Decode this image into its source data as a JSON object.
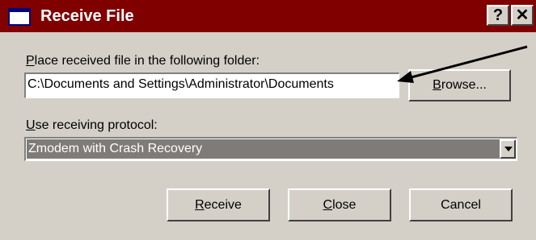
{
  "window": {
    "title": "Receive File",
    "help_glyph": "?",
    "close_glyph": "✕",
    "icon": "window-icon"
  },
  "folder": {
    "label_accel": "P",
    "label_rest": "lace received file in the following folder:",
    "value": "C:\\Documents and Settings\\Administrator\\Documents",
    "browse_accel": "B",
    "browse_rest": "rowse..."
  },
  "protocol": {
    "label_accel": "U",
    "label_rest": "se receiving protocol:",
    "selected": "Zmodem with Crash Recovery"
  },
  "buttons": {
    "receive_accel": "R",
    "receive_rest": "eceive",
    "close_accel": "C",
    "close_rest": "lose",
    "cancel": "Cancel"
  },
  "colors": {
    "titlebar": "#800000",
    "dialog_bg": "#d4d0c8",
    "selection": "#7f7b78"
  }
}
